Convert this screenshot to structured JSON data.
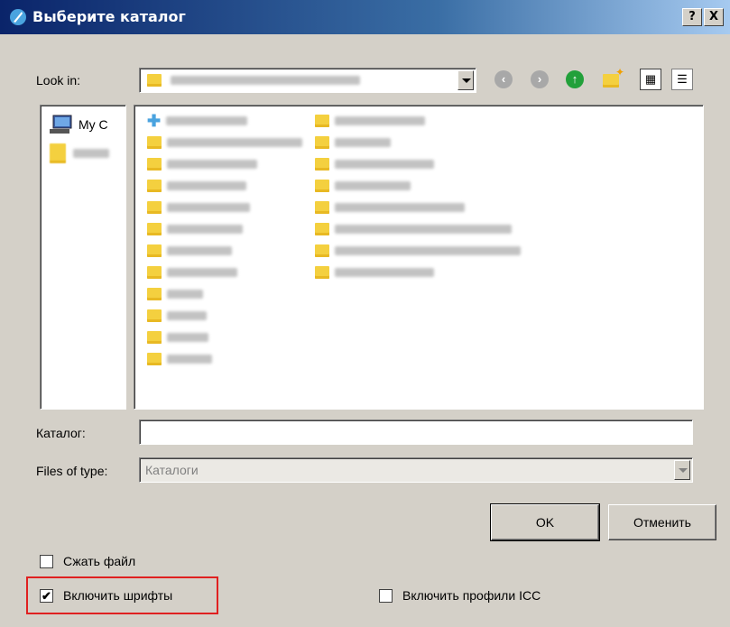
{
  "window": {
    "title": "Выберите каталог",
    "help_label": "?",
    "close_label": "X"
  },
  "look_in": {
    "label": "Look in:",
    "value_icon": "folder-icon"
  },
  "nav": {
    "back_icon": "back-arrow-icon",
    "forward_icon": "forward-arrow-icon",
    "up_icon": "up-arrow-icon",
    "new_folder_icon": "new-folder-icon",
    "list_view_icon": "list-view-icon",
    "detail_view_icon": "detail-view-icon"
  },
  "places": [
    {
      "label": "My C",
      "icon": "computer-icon"
    },
    {
      "label": "",
      "icon": "user-folder-icon"
    }
  ],
  "files": {
    "col1_count": 13,
    "col2_count": 9
  },
  "catalog": {
    "label": "Каталог:",
    "value": ""
  },
  "files_of_type": {
    "label": "Files of type:",
    "value": "Каталоги"
  },
  "buttons": {
    "ok": "OK",
    "cancel": "Отменить"
  },
  "options": {
    "compress": {
      "label": "Сжать файл",
      "checked": false
    },
    "embed_fonts": {
      "label": "Включить шрифты",
      "checked": true
    },
    "icc_profiles": {
      "label": "Включить профили ICC",
      "checked": false
    }
  },
  "colors": {
    "highlight_border": "#e02020",
    "titlebar_start": "#0a246a",
    "up_icon": "#22a03a"
  }
}
